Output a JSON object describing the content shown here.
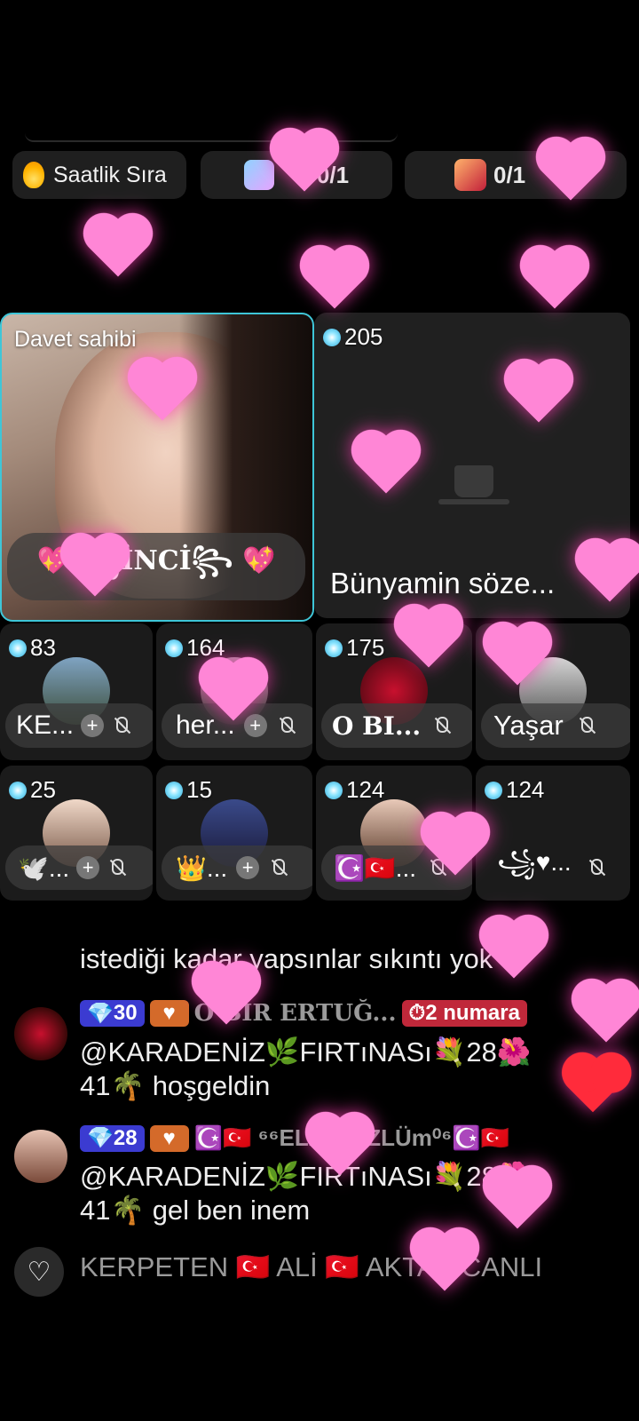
{
  "topbar": {
    "hourly_label": "Saatlik Sıra",
    "gift_count_1": "0/1",
    "gift_count_2": "0/1"
  },
  "host": {
    "label": "Davet sahibi",
    "name": "💖 ꧁İNCİ꧂ 💖"
  },
  "main_guest": {
    "score": "205",
    "name": "Bünyamin söze..."
  },
  "seats": [
    {
      "score": "83",
      "name": "KE..."
    },
    {
      "score": "164",
      "name": "her..."
    },
    {
      "score": "175",
      "name": "O BI..."
    },
    {
      "score": "27",
      "name": "Yaşar"
    },
    {
      "score": "25",
      "name": "🕊️..."
    },
    {
      "score": "15",
      "name": "👑..."
    },
    {
      "score": "124",
      "name": "☪️🇹🇷..."
    },
    {
      "score": "124",
      "name": "꧁♥..."
    }
  ],
  "chat": {
    "msg0_text": "istediği kadar yapsınlar sıkıntı yok",
    "msg1": {
      "level": "30",
      "user": "O BIR ERTUĞ...",
      "rank": "2 numara",
      "line1": "@KARADENİZ🌿FIRTıNASı💐28🌺",
      "line2": "41🌴 hoşgeldin"
    },
    "msg2": {
      "level": "28",
      "user": "☪️🇹🇷 ⁶⁶ELA GÖZLÜm⁰⁶☪️🇹🇷",
      "line1": "@KARADENİZ🌿FIRTıNASı💐28🌺",
      "line2": "41🌴 gel ben inem"
    },
    "msg3_text": "KERPETEN 🇹🇷 ALİ 🇹🇷 AKTAŞ CANLI"
  },
  "like_icon": "heart-icon"
}
